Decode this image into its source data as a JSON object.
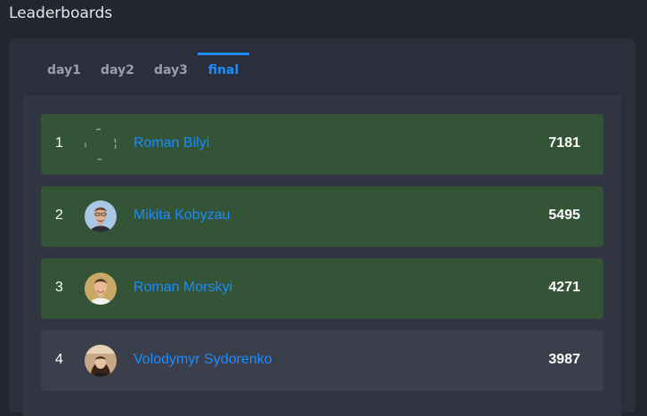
{
  "page": {
    "title": "Leaderboards"
  },
  "tabs": [
    {
      "label": "day1",
      "active": false
    },
    {
      "label": "day2",
      "active": false
    },
    {
      "label": "day3",
      "active": false
    },
    {
      "label": "final",
      "active": true
    }
  ],
  "colors": {
    "accent": "#1a8cff",
    "top_row_bg": "#335437",
    "row_bg": "#3b3f4c"
  },
  "leaderboard": [
    {
      "rank": "1",
      "name": "Roman Bilyi",
      "score": "7181",
      "avatar": "broken-avatar-image"
    },
    {
      "rank": "2",
      "name": "Mikita Kobyzau",
      "score": "5495",
      "avatar": "user-photo"
    },
    {
      "rank": "3",
      "name": "Roman Morskyi",
      "score": "4271",
      "avatar": "user-photo"
    },
    {
      "rank": "4",
      "name": "Volodymyr Sydorenko",
      "score": "3987",
      "avatar": "user-photo"
    }
  ]
}
